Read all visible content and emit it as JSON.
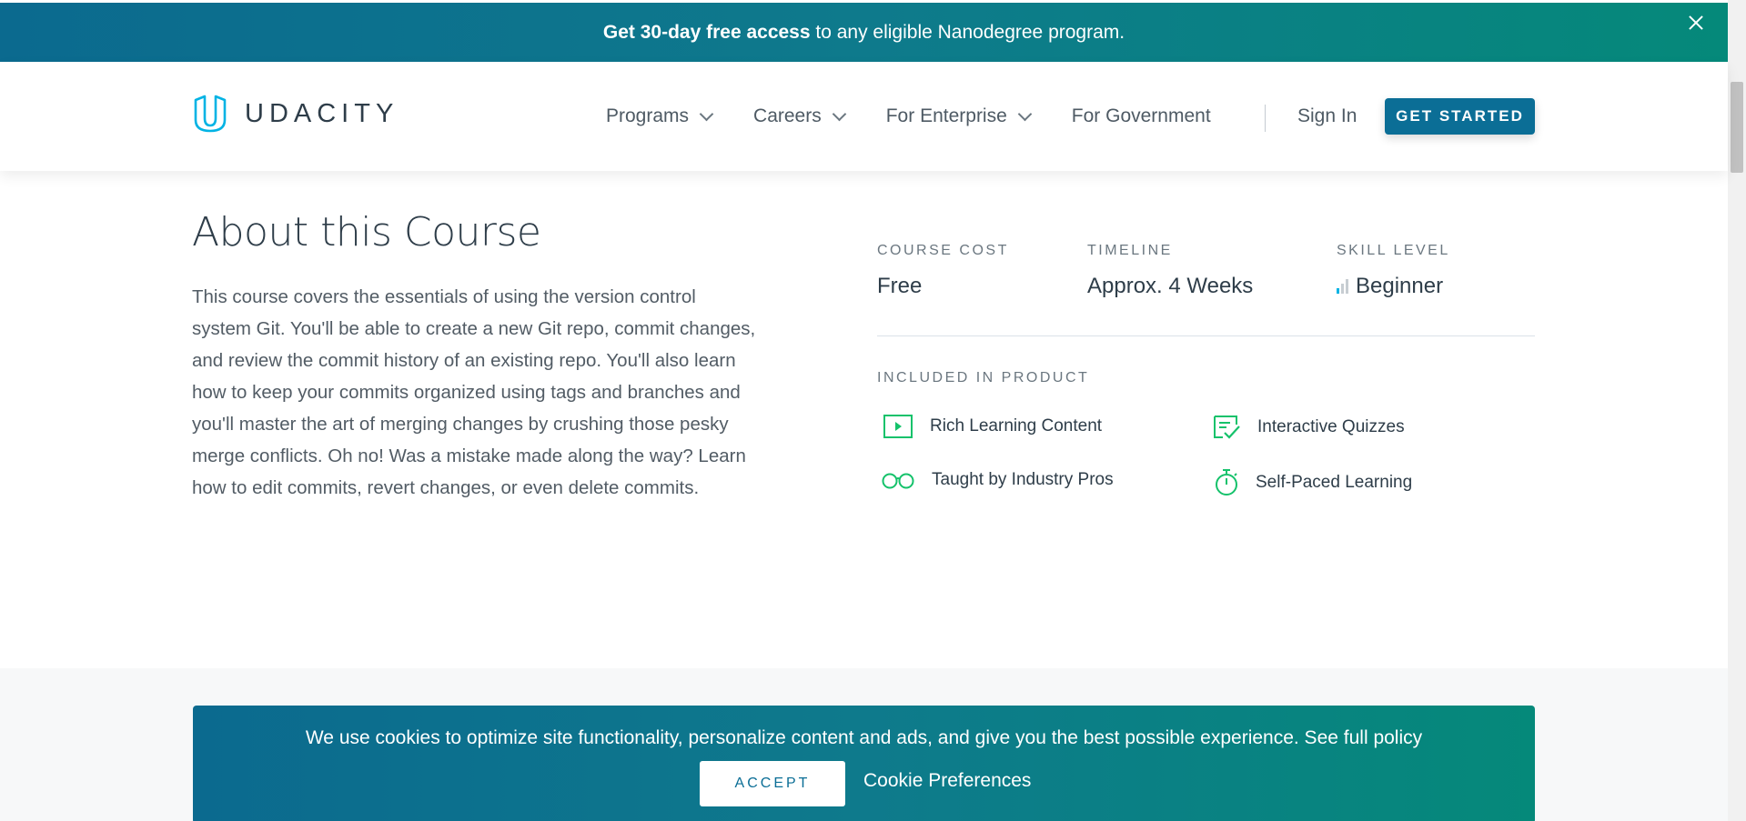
{
  "promo": {
    "bold": "Get 30-day free access",
    "rest": " to any eligible Nanodegree program.",
    "close_icon": "close-icon"
  },
  "header": {
    "logo_text": "UDACITY",
    "nav": [
      {
        "label": "Programs",
        "has_dropdown": true
      },
      {
        "label": "Careers",
        "has_dropdown": true
      },
      {
        "label": "For Enterprise",
        "has_dropdown": true
      },
      {
        "label": "For Government",
        "has_dropdown": false
      }
    ],
    "sign_in": "Sign In",
    "cta": "GET STARTED"
  },
  "about": {
    "title": "About this Course",
    "body": "This course covers the essentials of using the version control system Git. You'll be able to create a new Git repo, commit changes, and review the commit history of an existing repo. You'll also learn how to keep your commits organized using tags and branches and you'll master the art of merging changes by crushing those pesky merge conflicts. Oh no! Was a mistake made along the way? Learn how to edit commits, revert changes, or even delete commits."
  },
  "course_meta": {
    "cost_label": "COURSE COST",
    "cost_value": "Free",
    "timeline_label": "TIMELINE",
    "timeline_value": "Approx. 4 Weeks",
    "skill_label": "SKILL LEVEL",
    "skill_value": "Beginner",
    "skill_level_filled": 1,
    "skill_level_total": 3
  },
  "included": {
    "label": "INCLUDED IN PRODUCT",
    "items": [
      {
        "label": "Rich Learning Content",
        "icon": "video-icon"
      },
      {
        "label": "Interactive Quizzes",
        "icon": "quiz-icon"
      },
      {
        "label": "Taught by Industry Pros",
        "icon": "glasses-icon"
      },
      {
        "label": "Self-Paced Learning",
        "icon": "stopwatch-icon"
      }
    ]
  },
  "cookie": {
    "text": "We use cookies to optimize site functionality, personalize content and ads, and give you the best possible experience. See full policy",
    "accept": "ACCEPT",
    "preferences": "Cookie Preferences"
  },
  "colors": {
    "brand_blue": "#0b6e96",
    "brand_teal": "#05897a",
    "accent_green": "#15c26b",
    "logo_cyan": "#02b3e4"
  }
}
